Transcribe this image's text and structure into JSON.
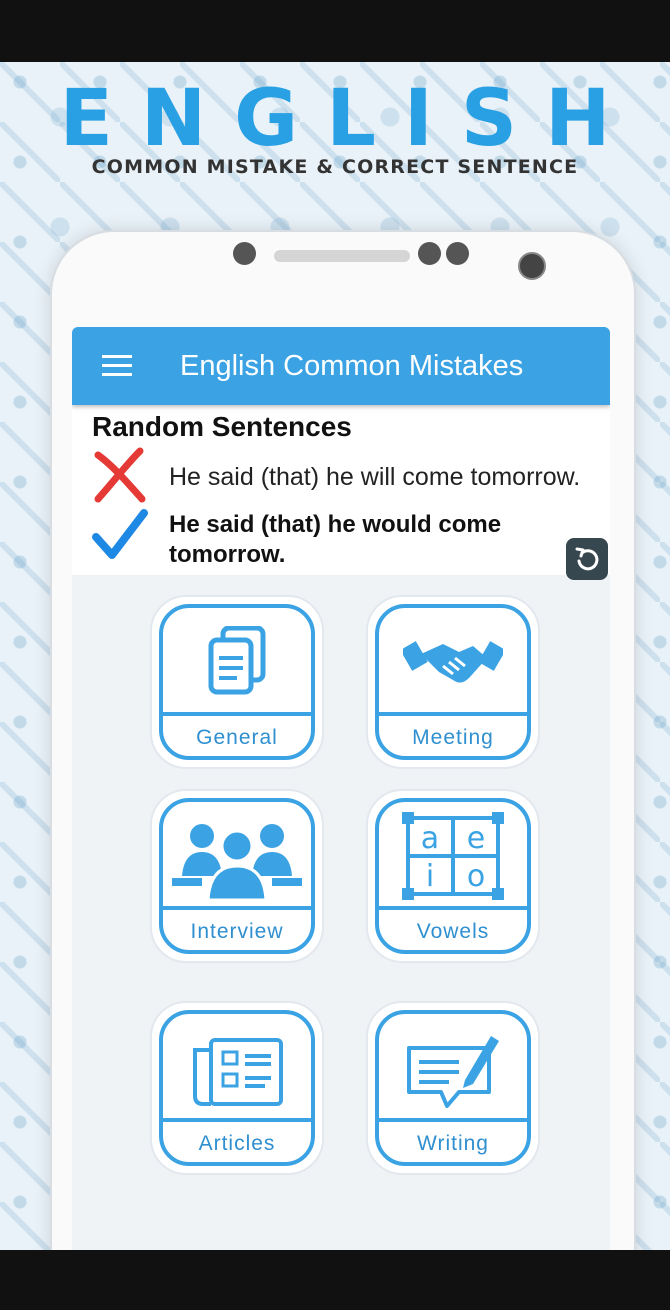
{
  "promo": {
    "title": "ENGLISH",
    "subtitle": "COMMON MISTAKE & CORRECT SENTENCE"
  },
  "appbar": {
    "title": "English Common Mistakes",
    "menu_icon": "hamburger-menu-icon"
  },
  "random_sentences": {
    "heading": "Random Sentences",
    "wrong": "He said (that) he will  come tomorrow.",
    "correct": "He said (that) he would come tomorrow.",
    "refresh_icon": "refresh-icon"
  },
  "categories": [
    {
      "label": "General",
      "icon": "document-icon"
    },
    {
      "label": "Meeting",
      "icon": "handshake-icon"
    },
    {
      "label": "Interview",
      "icon": "people-icon"
    },
    {
      "label": "Vowels",
      "icon": "vowels-grid-icon",
      "letters": [
        "a",
        "e",
        "i",
        "o"
      ]
    },
    {
      "label": "Articles",
      "icon": "newspaper-icon"
    },
    {
      "label": "Writing",
      "icon": "writing-icon"
    }
  ],
  "colors": {
    "accent": "#3ba3e4",
    "wrong": "#e53935",
    "correct": "#1e88e5"
  }
}
